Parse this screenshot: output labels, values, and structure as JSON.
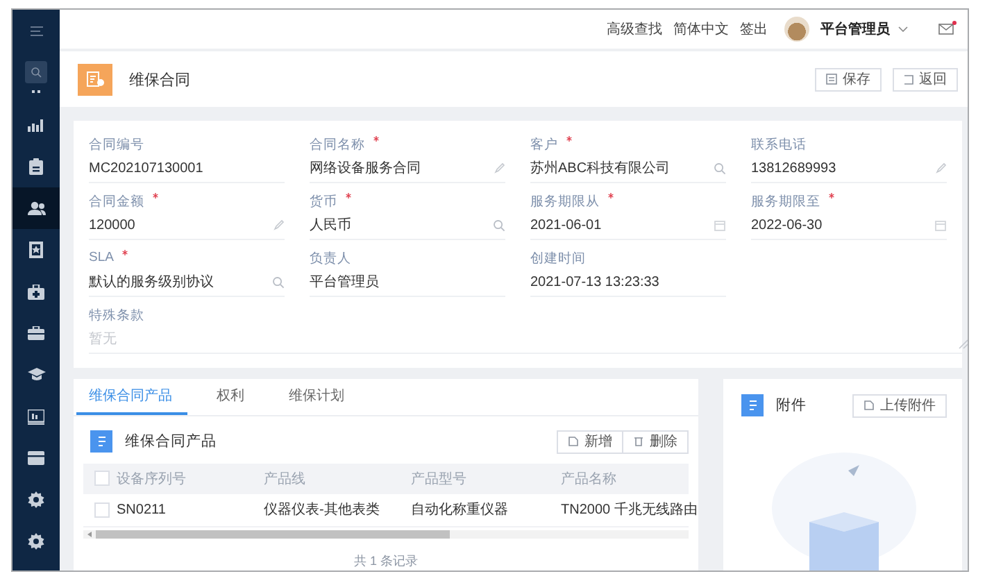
{
  "topbar": {
    "links": [
      "高级查找",
      "简体中文",
      "签出"
    ],
    "user": "平台管理员",
    "mail": {
      "unread": true
    }
  },
  "sidebar": {
    "items": [
      {
        "selected": false
      },
      {
        "selected": false
      },
      {
        "selected": true
      },
      {
        "selected": false
      },
      {
        "selected": false
      },
      {
        "selected": false
      },
      {
        "selected": false
      },
      {
        "selected": false
      },
      {
        "selected": false
      },
      {
        "selected": false
      },
      {
        "selected": false
      }
    ]
  },
  "header": {
    "title": "维保合同",
    "buttons": [
      {
        "kind": "save",
        "label": "保存"
      },
      {
        "kind": "back",
        "label": "返回"
      }
    ]
  },
  "form": {
    "fields": [
      {
        "label": "合同编号",
        "required": false,
        "value": "MC202107130001",
        "kind": "plain"
      },
      {
        "label": "合同名称",
        "required": true,
        "value": "网络设备服务合同",
        "kind": "edit"
      },
      {
        "label": "客户",
        "required": true,
        "value": "苏州ABC科技有限公司",
        "kind": "lookup"
      },
      {
        "label": "联系电话",
        "required": false,
        "value": "13812689993",
        "kind": "edit"
      },
      {
        "label": "合同金额",
        "required": true,
        "value": "120000",
        "kind": "edit"
      },
      {
        "label": "货币",
        "required": true,
        "value": "人民币",
        "kind": "lookup"
      },
      {
        "label": "服务期限从",
        "required": true,
        "value": "2021-06-01",
        "kind": "date"
      },
      {
        "label": "服务期限至",
        "required": true,
        "value": "2022-06-30",
        "kind": "date"
      },
      {
        "label": "SLA",
        "required": true,
        "value": "默认的服务级别协议",
        "kind": "lookup"
      },
      {
        "label": "负责人",
        "required": false,
        "value": "平台管理员",
        "kind": "plain"
      },
      {
        "label": "创建时间",
        "required": false,
        "value": "2021-07-13 13:23:33",
        "kind": "plain"
      },
      {
        "label": "特殊条款",
        "required": false,
        "placeholder": "暂无",
        "kind": "textarea"
      }
    ]
  },
  "products": {
    "tabs": [
      {
        "label": "维保合同产品",
        "selected": true
      },
      {
        "label": "权利",
        "selected": false
      },
      {
        "label": "维保计划",
        "selected": false
      }
    ],
    "title": "维保合同产品",
    "buttons": [
      {
        "kind": "add",
        "label": "新增"
      },
      {
        "kind": "delete",
        "label": "删除"
      }
    ],
    "table": {
      "select_all": {
        "checked": false
      },
      "columns": [
        "设备序列号",
        "产品线",
        "产品型号",
        "产品名称"
      ],
      "rows": [
        {
          "checked": false,
          "cells": [
            "SN0211",
            "仪器仪表-其他表类",
            "自动化称重仪器",
            "TN2000 千兆无线路由"
          ]
        }
      ],
      "footer": "共 1 条记录"
    }
  },
  "attachments": {
    "title": "附件",
    "button": "上传附件"
  }
}
